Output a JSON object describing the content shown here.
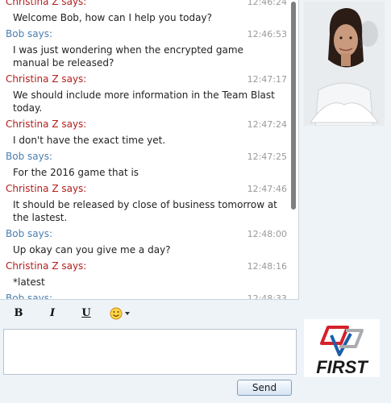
{
  "chat": {
    "messages": [
      {
        "sender": "Christina Z says:",
        "role": "agent",
        "time": "12:46:24",
        "text": "Welcome Bob, how can I help you today?"
      },
      {
        "sender": "Bob says:",
        "role": "visitor",
        "time": "12:46:53",
        "text": "I was just wondering when the encrypted game manual be released?"
      },
      {
        "sender": "Christina Z says:",
        "role": "agent",
        "time": "12:47:17",
        "text": "We should include more information in the Team Blast today."
      },
      {
        "sender": "Christina Z says:",
        "role": "agent",
        "time": "12:47:24",
        "text": "I don't have the exact time yet."
      },
      {
        "sender": "Bob says:",
        "role": "visitor",
        "time": "12:47:25",
        "text": "For the 2016 game that is"
      },
      {
        "sender": "Christina Z says:",
        "role": "agent",
        "time": "12:47:46",
        "text": "It should be released by close of business tomorrow at the lastest."
      },
      {
        "sender": "Bob says:",
        "role": "visitor",
        "time": "12:48:00",
        "text": "Up okay can you give me a day?"
      },
      {
        "sender": "Christina Z says:",
        "role": "agent",
        "time": "12:48:16",
        "text": "*latest"
      },
      {
        "sender": "Bob says:",
        "role": "visitor",
        "time": "12:48:33",
        "text": ""
      }
    ]
  },
  "toolbar": {
    "bold_label": "B",
    "italic_label": "I",
    "underline_label": "U"
  },
  "compose": {
    "value": "",
    "send_label": "Send"
  },
  "logo": {
    "text": "FIRST"
  },
  "colors": {
    "agent_name": "#b31e1e",
    "visitor_name": "#4a7eb0",
    "timestamp": "#9a9a9a",
    "logo_red": "#d6202a",
    "logo_blue": "#1a5fa8"
  },
  "icons": [
    "smiley-icon",
    "chevron-down-icon"
  ]
}
